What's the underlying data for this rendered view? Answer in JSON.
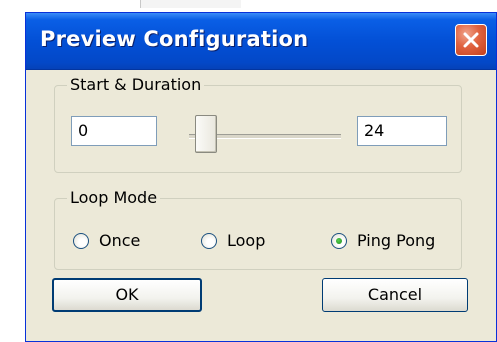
{
  "window": {
    "title": "Preview Configuration"
  },
  "start_duration": {
    "group_label": "Start & Duration",
    "start_value": "0",
    "end_value": "24"
  },
  "loop_mode": {
    "group_label": "Loop Mode",
    "options": [
      {
        "label": "Once",
        "selected": false
      },
      {
        "label": "Loop",
        "selected": false
      },
      {
        "label": "Ping Pong",
        "selected": true
      }
    ]
  },
  "buttons": {
    "ok_label": "OK",
    "cancel_label": "Cancel"
  },
  "icons": {
    "close": "close-icon",
    "radio_selected_color": "#2e9d2c"
  }
}
